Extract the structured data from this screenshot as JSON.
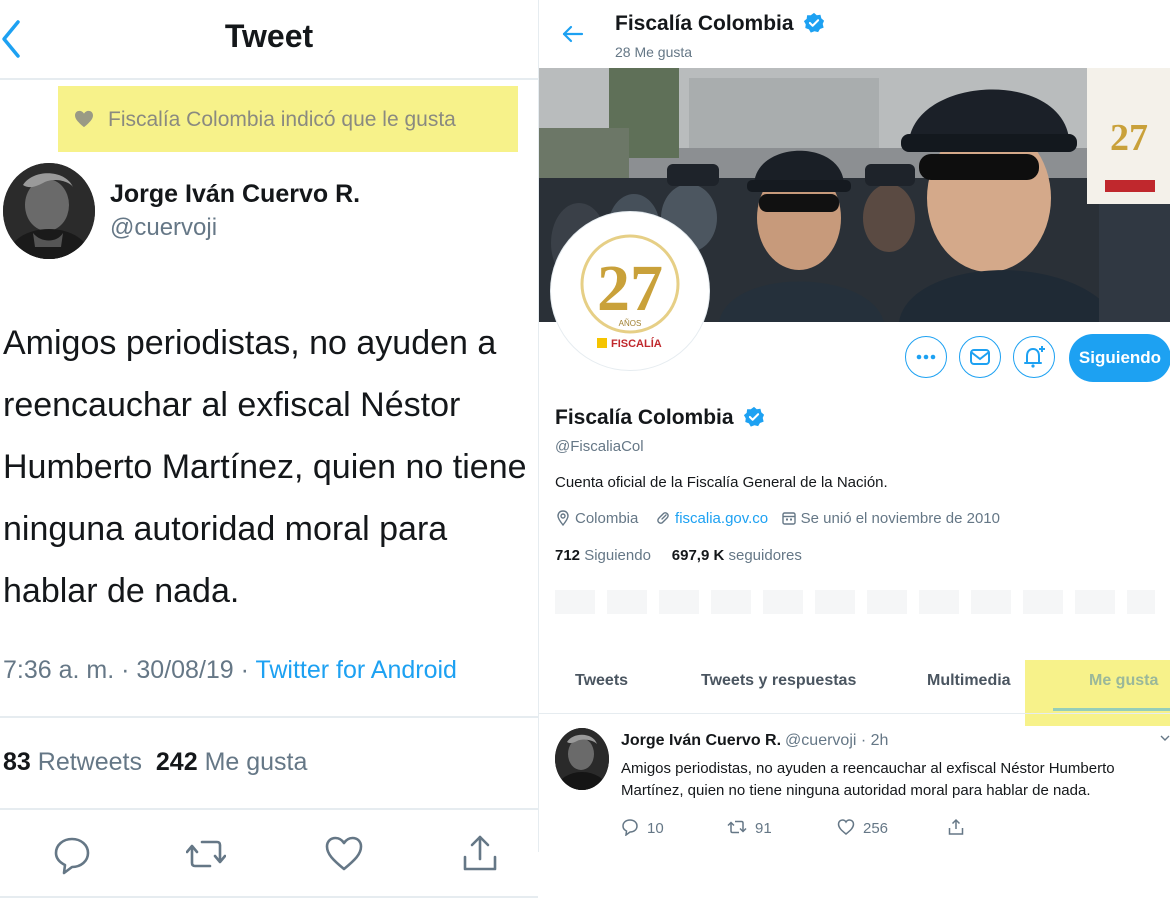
{
  "left": {
    "header_title": "Tweet",
    "liked_notice": "Fiscalía Colombia indicó que le gusta",
    "author_name": "Jorge Iván Cuervo R.",
    "author_handle": "@cuervoji",
    "tweet_text": "Amigos periodistas, no ayuden a reencauchar al exfiscal Néstor Humberto Martínez, quien no tiene ninguna autoridad moral para hablar de nada.",
    "time": "7:36 a. m. · 30/08/19 · ",
    "source": "Twitter for Android",
    "retweets_count": "83",
    "retweets_label": "Retweets",
    "likes_count": "242",
    "likes_label": "Me gusta"
  },
  "right": {
    "title": "Fiscalía Colombia",
    "subtitle": "28 Me gusta",
    "banner_logo_number": "27",
    "banner_logo_years": "AÑOS",
    "banner_logo_brand": "FISCALÍA",
    "follow_button": "Siguiendo",
    "profile_name": "Fiscalía Colombia",
    "profile_handle": "@FiscaliaCol",
    "bio": "Cuenta oficial de la Fiscalía General de la Nación.",
    "location": "Colombia",
    "website": "fiscalia.gov.co",
    "joined": "Se unió el noviembre de 2010",
    "following_count": "712",
    "following_label": "Siguiendo",
    "followers_count": "697,9 K",
    "followers_label": "seguidores",
    "tabs": [
      "Tweets",
      "Tweets y respuestas",
      "Multimedia",
      "Me gusta"
    ],
    "tweet": {
      "author": "Jorge Iván Cuervo R.",
      "meta": "@cuervoji · 2h",
      "text": "Amigos periodistas, no ayuden a reencauchar al exfiscal Néstor Humberto Martínez, quien no tiene ninguna autoridad moral para hablar de nada.",
      "replies": "10",
      "retweets": "91",
      "likes": "256"
    }
  },
  "colors": {
    "twitter_blue": "#1da1f2",
    "highlight_yellow": "#f7f28a",
    "secondary_text": "#657786",
    "verified_badge": "#1da1f2"
  },
  "icons": [
    "back-chevron-icon",
    "heart-icon",
    "reply-icon",
    "retweet-icon",
    "like-icon",
    "share-icon",
    "verified-badge-icon",
    "more-icon",
    "mail-icon",
    "bell-plus-icon",
    "location-icon",
    "link-icon",
    "calendar-icon"
  ]
}
